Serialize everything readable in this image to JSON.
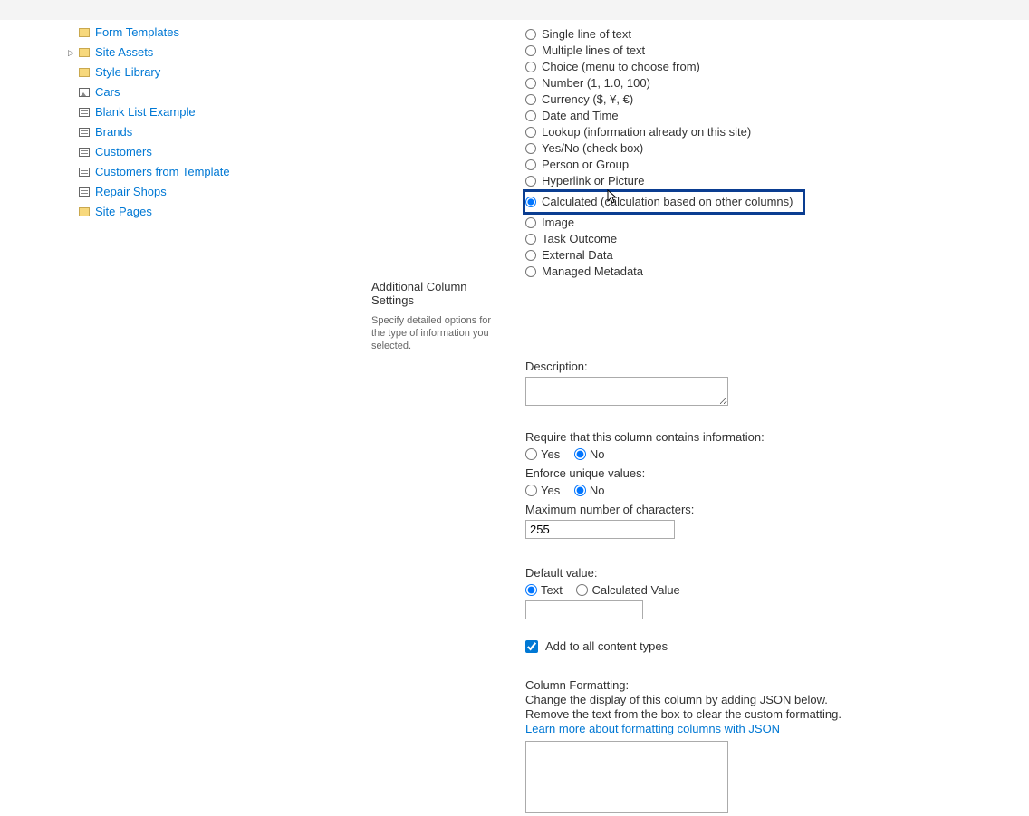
{
  "sidebar": {
    "items": [
      {
        "label": "Form Templates",
        "iconType": "folder",
        "expandable": false
      },
      {
        "label": "Site Assets",
        "iconType": "folder",
        "expandable": true
      },
      {
        "label": "Style Library",
        "iconType": "folder",
        "expandable": false
      },
      {
        "label": "Cars",
        "iconType": "picture",
        "expandable": false
      },
      {
        "label": "Blank List Example",
        "iconType": "list",
        "expandable": false
      },
      {
        "label": "Brands",
        "iconType": "list",
        "expandable": false
      },
      {
        "label": "Customers",
        "iconType": "list",
        "expandable": false
      },
      {
        "label": "Customers from Template",
        "iconType": "list",
        "expandable": false
      },
      {
        "label": "Repair Shops",
        "iconType": "list",
        "expandable": false
      },
      {
        "label": "Site Pages",
        "iconType": "folder",
        "expandable": false
      }
    ]
  },
  "columnTypes": [
    {
      "label": "Single line of text"
    },
    {
      "label": "Multiple lines of text"
    },
    {
      "label": "Choice (menu to choose from)"
    },
    {
      "label": "Number (1, 1.0, 100)"
    },
    {
      "label": "Currency ($, ¥, €)"
    },
    {
      "label": "Date and Time"
    },
    {
      "label": "Lookup (information already on this site)"
    },
    {
      "label": "Yes/No (check box)"
    },
    {
      "label": "Person or Group"
    },
    {
      "label": "Hyperlink or Picture"
    },
    {
      "label": "Calculated (calculation based on other columns)",
      "highlighted": true,
      "checked": true
    },
    {
      "label": "Image"
    },
    {
      "label": "Task Outcome"
    },
    {
      "label": "External Data"
    },
    {
      "label": "Managed Metadata"
    }
  ],
  "additionalSettings": {
    "heading": "Additional Column Settings",
    "subtext": "Specify detailed options for the type of information you selected."
  },
  "form": {
    "descriptionLabel": "Description:",
    "requireLabel": "Require that this column contains information:",
    "enforceLabel": "Enforce unique values:",
    "yes": "Yes",
    "no": "No",
    "maxCharsLabel": "Maximum number of characters:",
    "maxCharsValue": "255",
    "defaultValueLabel": "Default value:",
    "text": "Text",
    "calculatedValue": "Calculated Value",
    "addToContentTypes": "Add to all content types",
    "columnFormattingHeading": "Column Formatting:",
    "columnFormattingLine1": "Change the display of this column by adding JSON below.",
    "columnFormattingLine2": "Remove the text from the box to clear the custom formatting.",
    "learnMoreLink": "Learn more about formatting columns with JSON"
  }
}
